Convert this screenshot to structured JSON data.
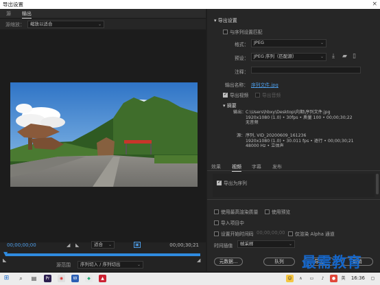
{
  "window": {
    "title": "导出设置",
    "close_glyph": "×"
  },
  "left_tabs": [
    "源",
    "输出"
  ],
  "source_scale": {
    "label": "源缩放：",
    "value": "缩放以适合"
  },
  "transport": {
    "timecode_start": "00;00;00;00",
    "timecode_end": "00;00;30;21",
    "fit_value": "适合",
    "range_label": "源范围",
    "range_value": "序列切入 / 序列切出",
    "progress": 1.0
  },
  "export_settings": {
    "header": "导出设置",
    "match_sequence_label": "与序列设置匹配",
    "format_label": "格式：",
    "format_value": "JPEG",
    "preset_label": "预设：",
    "preset_value": "JPEG 序列（匹配源）",
    "comments_label": "注释：",
    "output_name_label": "输出名称：",
    "output_name_value": "序列文件.jpg",
    "export_video_label": "导出视频",
    "export_audio_label": "导出音频"
  },
  "summary": {
    "header": "摘要",
    "output_label": "输出：",
    "output_lines": [
      "C:\\Users\\hbxy\\Desktop\\向期\\序列文件.jpg",
      "1920x1080 (1.0) • 30fps • 质量 100 • 00;00;30;22",
      "无音频"
    ],
    "source_label": "源：",
    "source_lines": [
      "序列, VID_20200609_161236",
      "1920x1080 (1.0) • 30.011 fps • 逐行 • 00;00;30;21",
      "48000 Hz • 立体声"
    ]
  },
  "right_tabs": [
    "效果",
    "视频",
    "字幕",
    "发布"
  ],
  "video_tab": {
    "export_as_sequence_label": "导出为序列"
  },
  "options": {
    "max_render_quality": "使用最高渲染质量",
    "use_previews": "使用预览",
    "import_into_project": "导入项目中",
    "set_start_timecode": "设置开始时间码",
    "start_timecode_value": "00;00;00;00",
    "render_alpha_only": "仅渲染 Alpha 通道",
    "time_interpolation_label": "时间插值",
    "time_interpolation_value": "帧采样"
  },
  "buttons": {
    "metadata": "元数据...",
    "queue": "队列",
    "export": "导出",
    "cancel": "取消"
  },
  "watermark": "最需教育",
  "taskbar": {
    "clock": "16:36"
  },
  "colors": {
    "accent_blue": "#2f8be0",
    "link": "#4d9de8",
    "watermark": "#1566c9"
  }
}
